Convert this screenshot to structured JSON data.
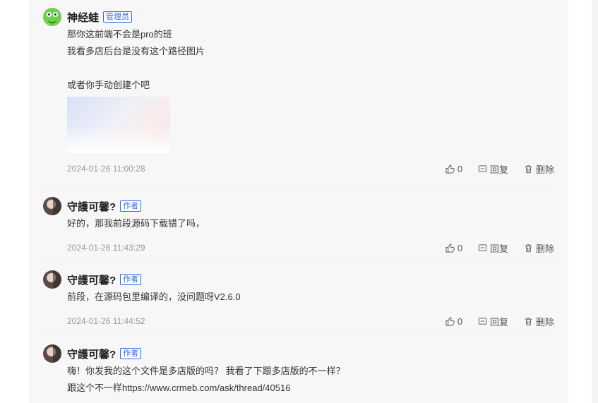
{
  "comments": [
    {
      "author": "神经蛙",
      "badge": "管理员",
      "lines": [
        "那你这前端不会是pro的班",
        "我看多店后台是没有这个路径图片",
        "",
        "或者你手动创建个吧"
      ],
      "time": "2024-01-26 11:00:28",
      "likes": "0",
      "reply": "回复",
      "delete": "删除"
    },
    {
      "author": "守護可馨?",
      "badge": "作者",
      "lines": [
        "好的，那我前段源码下载错了吗，"
      ],
      "time": "2024-01-26 11:43:29",
      "likes": "0",
      "reply": "回复",
      "delete": "删除"
    },
    {
      "author": "守護可馨?",
      "badge": "作者",
      "lines": [
        "前段，在源码包里编译的，没问题呀V2.6.0"
      ],
      "time": "2024-01-26 11:44:52",
      "likes": "0",
      "reply": "回复",
      "delete": "删除"
    },
    {
      "author": "守護可馨?",
      "badge": "作者",
      "lines": [
        "嗨！你发我的这个文件是多店版的吗？ 我看了下跟多店版的不一样？",
        "跟这个不一样https://www.crmeb.com/ask/thread/40516"
      ]
    }
  ],
  "icons": {
    "like": "thumbs-up-icon",
    "reply": "comment-icon",
    "delete": "trash-icon"
  },
  "colors": {
    "badge": "#2d6be4",
    "panel": "#f7f7f8"
  }
}
